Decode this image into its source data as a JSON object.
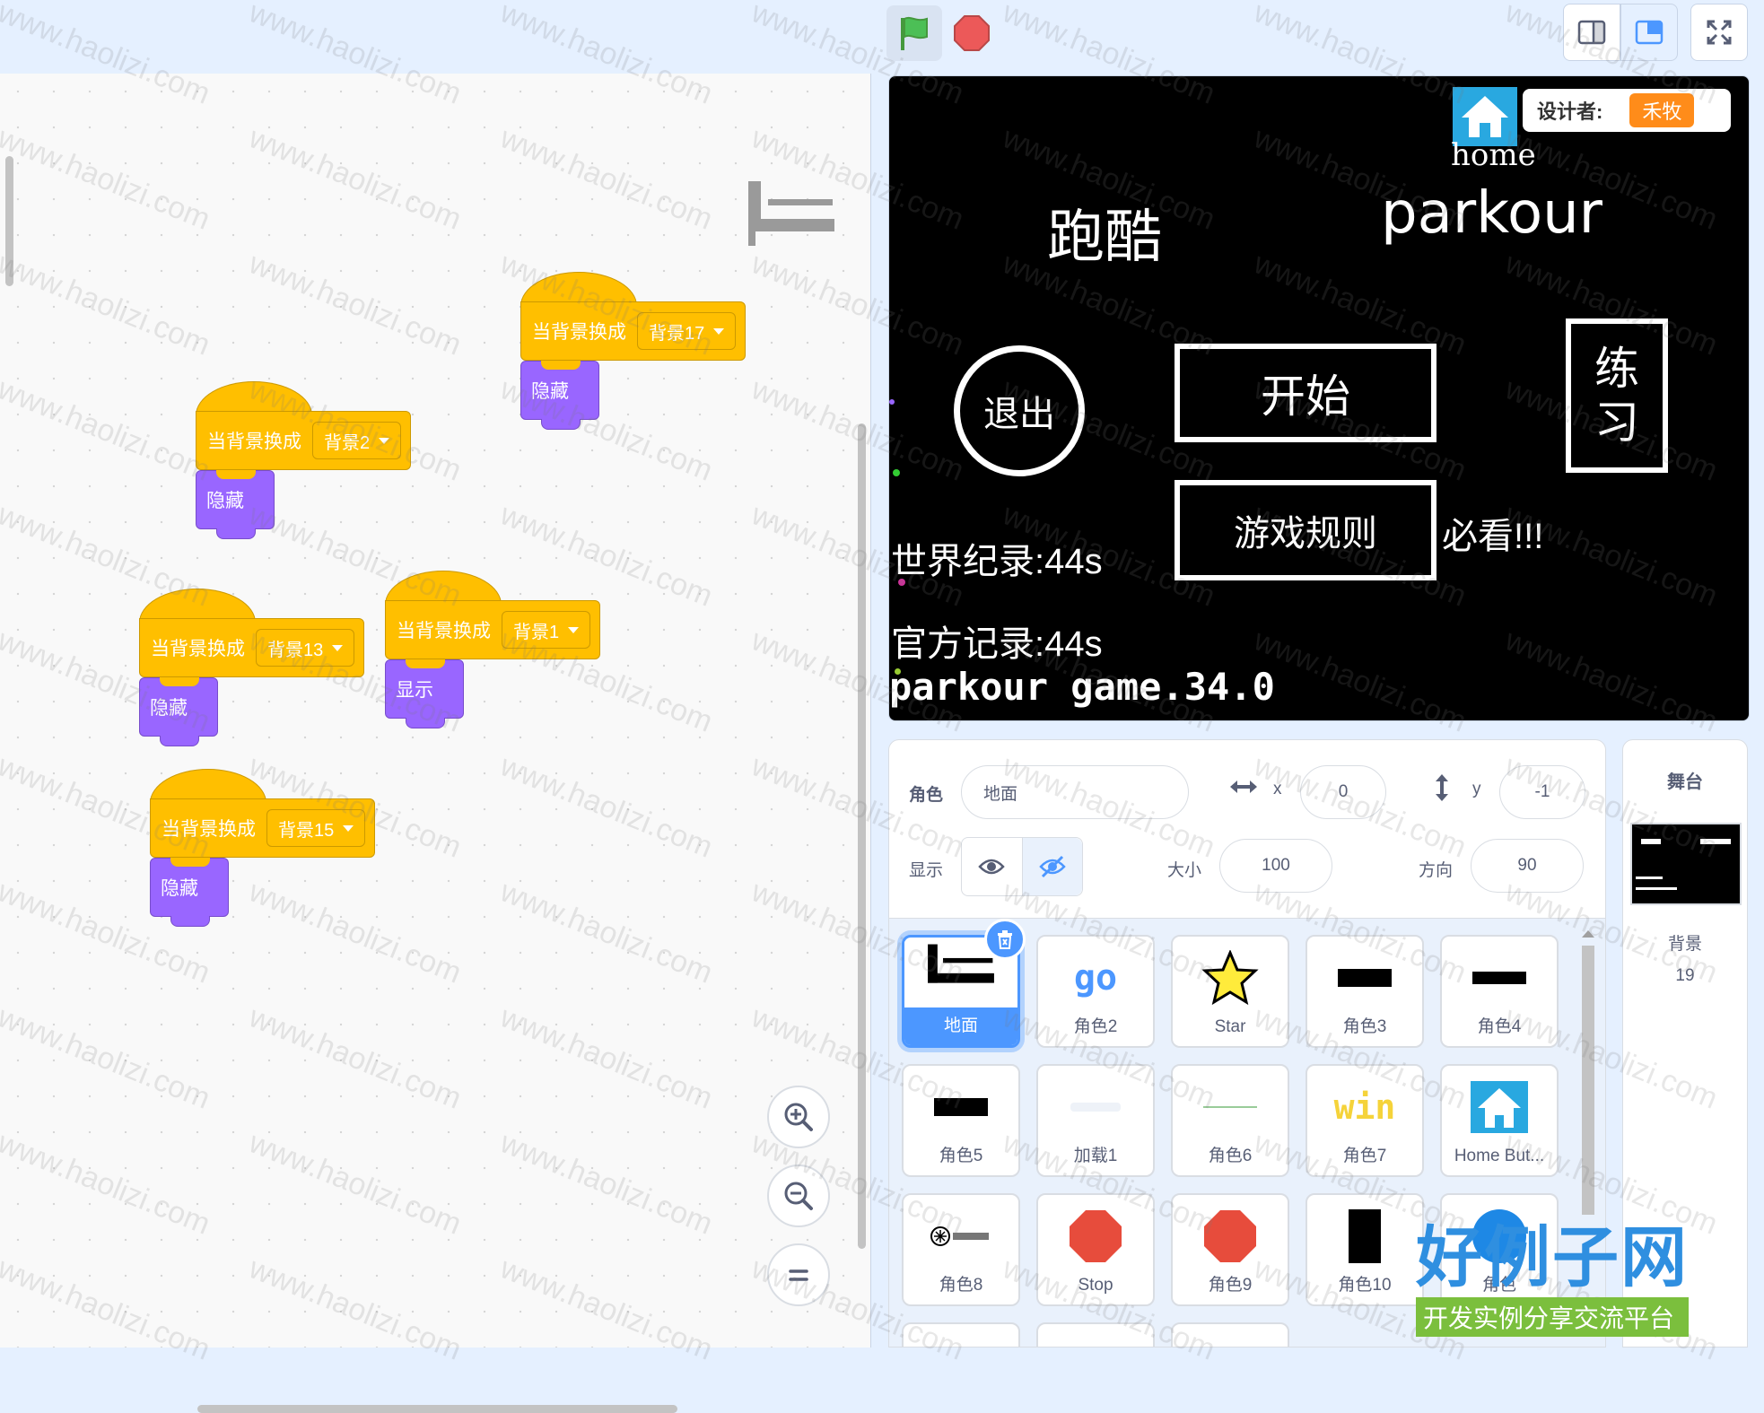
{
  "controls": {
    "flag_icon": "green-flag-icon",
    "stop_icon": "stop-sign-icon"
  },
  "code_blocks": [
    {
      "event": "当背景换成",
      "backdrop": "背景17",
      "action": "隐藏"
    },
    {
      "event": "当背景换成",
      "backdrop": "背景2",
      "action": "隐藏"
    },
    {
      "event": "当背景换成",
      "backdrop": "背景13",
      "action": "隐藏"
    },
    {
      "event": "当背景换成",
      "backdrop": "背景1",
      "action": "显示"
    },
    {
      "event": "当背景换成",
      "backdrop": "背景15",
      "action": "隐藏"
    }
  ],
  "stage": {
    "home_label": "home",
    "designer_label": "设计者:",
    "designer_name": "禾牧",
    "title_cn": "跑酷",
    "title_en": "parkour",
    "exit": "退出",
    "start": "开始",
    "practice_1": "练",
    "practice_2": "习",
    "rules": "游戏规则",
    "must_see": "必看!!!",
    "world_record": "世界纪录:44s",
    "official_record": "官方记录:44s",
    "version": "parkour game.34.0"
  },
  "sprite_info": {
    "sprite_label": "角色",
    "sprite_name": "地面",
    "x_label": "x",
    "x_value": "0",
    "y_label": "y",
    "y_value": "-1",
    "show_label": "显示",
    "size_label": "大小",
    "size_value": "100",
    "direction_label": "方向",
    "direction_value": "90"
  },
  "sprites": [
    {
      "name": "地面",
      "icon": "ground-icon"
    },
    {
      "name": "角色2",
      "icon": "go-text-icon"
    },
    {
      "name": "Star",
      "icon": "star-icon"
    },
    {
      "name": "角色3",
      "icon": "start-button-icon"
    },
    {
      "name": "角色4",
      "icon": "rules-button-icon"
    },
    {
      "name": "角色5",
      "icon": "back-button-icon"
    },
    {
      "name": "加载1",
      "icon": "loading-icon"
    },
    {
      "name": "角色6",
      "icon": "line-icon"
    },
    {
      "name": "角色7",
      "icon": "win-text-icon"
    },
    {
      "name": "Home But...",
      "icon": "home-icon"
    },
    {
      "name": "角色8",
      "icon": "logo-icon"
    },
    {
      "name": "Stop",
      "icon": "stop-octagon-icon"
    },
    {
      "name": "角色9",
      "icon": "stop-octagon-icon"
    },
    {
      "name": "角色10",
      "icon": "practice-icon"
    },
    {
      "name": "角色",
      "icon": "blue-circle-icon"
    }
  ],
  "stage_panel": {
    "title": "舞台",
    "backdrop_label": "背景",
    "backdrop_count": "19"
  },
  "watermark": {
    "text": "www.haolizi.com",
    "logo_title": "好例子网",
    "logo_subtitle": "开发实例分享交流平台"
  }
}
